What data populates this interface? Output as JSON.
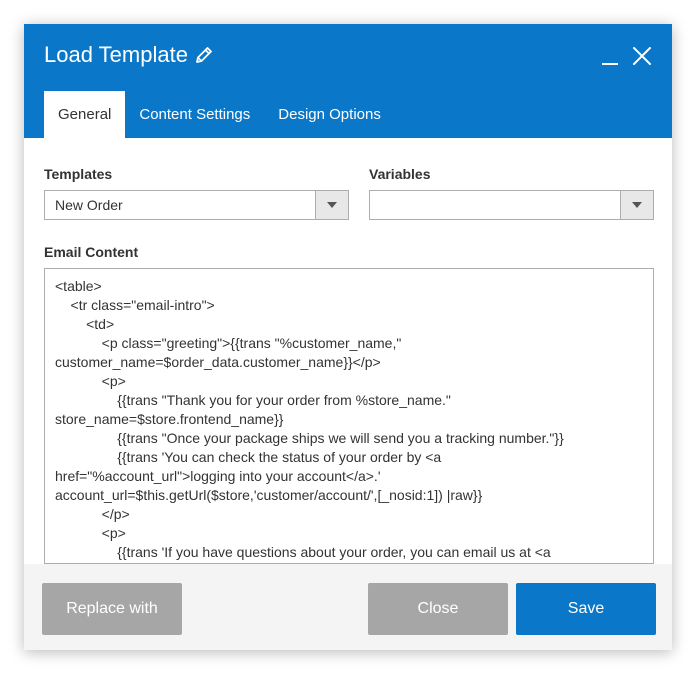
{
  "dialog": {
    "title": "Load Template"
  },
  "tabs": [
    {
      "label": "General"
    },
    {
      "label": "Content Settings"
    },
    {
      "label": "Design Options"
    }
  ],
  "fields": {
    "templates": {
      "label": "Templates",
      "value": "New Order"
    },
    "variables": {
      "label": "Variables",
      "value": ""
    },
    "email_content": {
      "label": "Email Content",
      "lines": [
        "<table>",
        "    <tr class=\"email-intro\">",
        "        <td>",
        "            <p class=\"greeting\">{{trans \"%customer_name,\"",
        "customer_name=$order_data.customer_name}}</p>",
        "            <p>",
        "                {{trans \"Thank you for your order from %store_name.\"",
        "store_name=$store.frontend_name}}",
        "                {{trans \"Once your package ships we will send you a tracking number.\"}}",
        "                {{trans 'You can check the status of your order by <a",
        "href=\"%account_url\">logging into your account</a>.'",
        "account_url=$this.getUrl($store,'customer/account/',[_nosid:1]) |raw}}",
        "            </p>",
        "            <p>",
        "                {{trans 'If you have questions about your order, you can email us at <a"
      ]
    }
  },
  "footer": {
    "replace_label": "Replace with",
    "close_label": "Close",
    "save_label": "Save"
  },
  "colors": {
    "accent": "#0a77c8",
    "disabled_button": "#a6a6a6"
  },
  "icons": {
    "title": "pencil-icon",
    "minimize": "minimize-icon",
    "close": "close-icon",
    "dropdown": "chevron-down-icon"
  }
}
